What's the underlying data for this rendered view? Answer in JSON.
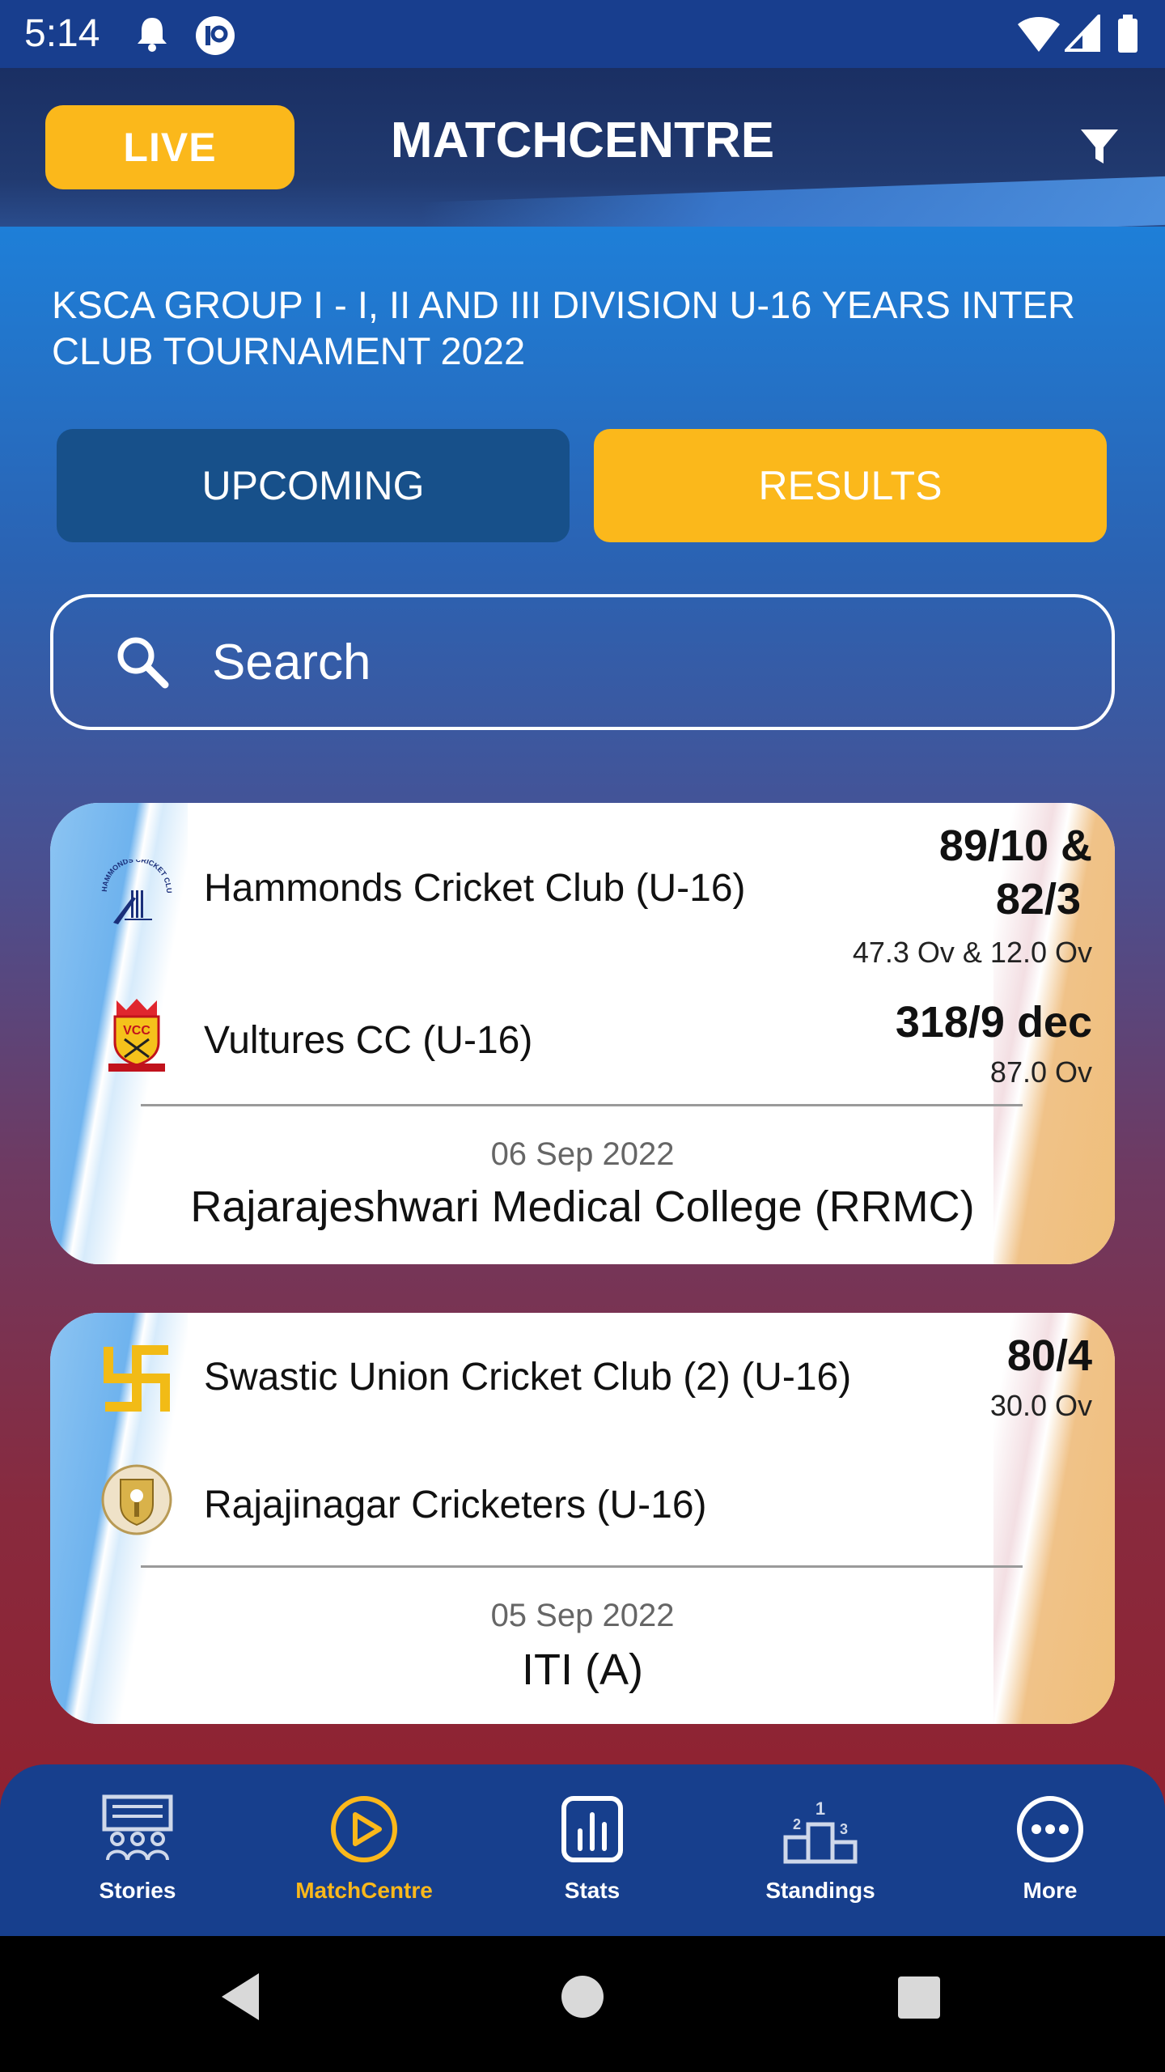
{
  "status_bar": {
    "time": "5:14"
  },
  "header": {
    "live_label": "LIVE",
    "title": "MATCHCENTRE"
  },
  "tournament_title": "KSCA GROUP I - I, II AND III DIVISION U-16 YEARS INTER CLUB TOURNAMENT 2022",
  "tabs": {
    "upcoming": "UPCOMING",
    "results": "RESULTS",
    "active": "results"
  },
  "search": {
    "placeholder": "Search"
  },
  "matches": [
    {
      "team1": {
        "name": "Hammonds Cricket Club (U-16)",
        "score_line1": "89/10  &",
        "score_line2": "82/3",
        "overs": "47.3 Ov  & 12.0 Ov",
        "logo_text": "HAMMONDS CRICKET CLUB"
      },
      "team2": {
        "name": "Vultures CC (U-16)",
        "score": "318/9 dec",
        "overs": "87.0 Ov",
        "logo_text": "VCC"
      },
      "date": "06 Sep 2022",
      "venue": "Rajarajeshwari Medical College (RRMC)"
    },
    {
      "team1": {
        "name": "Swastic Union Cricket Club (2) (U-16)",
        "score": "80/4",
        "overs": "30.0 Ov"
      },
      "team2": {
        "name": "Rajajinagar Cricketers (U-16)"
      },
      "date": "05 Sep 2022",
      "venue": "ITI (A)"
    }
  ],
  "bottom_nav": [
    {
      "label": "Stories",
      "icon": "stories-icon"
    },
    {
      "label": "MatchCentre",
      "icon": "play-circle-icon",
      "active": true
    },
    {
      "label": "Stats",
      "icon": "bar-chart-icon"
    },
    {
      "label": "Standings",
      "icon": "podium-icon"
    },
    {
      "label": "More",
      "icon": "more-dots-icon"
    }
  ],
  "colors": {
    "accent": "#fbb81b",
    "nav_bg": "#173f8d",
    "header_bg": "#1a2f63"
  }
}
